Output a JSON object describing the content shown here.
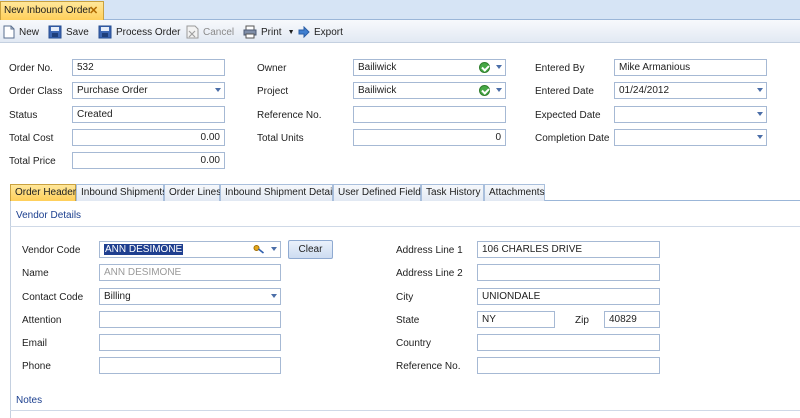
{
  "window": {
    "tab_title": "New Inbound Order",
    "close_glyph": "✕"
  },
  "toolbar": {
    "new": "New",
    "save": "Save",
    "process_order": "Process Order",
    "cancel": "Cancel",
    "print": "Print",
    "export": "Export"
  },
  "form": {
    "order_no": {
      "label": "Order No.",
      "value": "532"
    },
    "order_class": {
      "label": "Order Class",
      "value": "Purchase Order"
    },
    "status": {
      "label": "Status",
      "value": "Created"
    },
    "total_cost": {
      "label": "Total Cost",
      "value": "0.00"
    },
    "total_price": {
      "label": "Total Price",
      "value": "0.00"
    },
    "owner": {
      "label": "Owner",
      "value": "Bailiwick"
    },
    "project": {
      "label": "Project",
      "value": "Bailiwick"
    },
    "reference_no": {
      "label": "Reference No.",
      "value": ""
    },
    "total_units": {
      "label": "Total Units",
      "value": "0"
    },
    "entered_by": {
      "label": "Entered By",
      "value": "Mike Armanious"
    },
    "entered_date": {
      "label": "Entered Date",
      "value": "01/24/2012"
    },
    "expected_date": {
      "label": "Expected Date",
      "value": ""
    },
    "completion_date": {
      "label": "Completion Date",
      "value": ""
    }
  },
  "subtabs": [
    "Order Header",
    "Inbound Shipments",
    "Order Lines",
    "Inbound Shipment Details",
    "User Defined Fields",
    "Task History",
    "Attachments"
  ],
  "vendor": {
    "section_title": "Vendor Details",
    "vendor_code": {
      "label": "Vendor Code",
      "value": "ANN DESIMONE"
    },
    "clear_button": "Clear",
    "name": {
      "label": "Name",
      "value": "ANN DESIMONE"
    },
    "contact_code": {
      "label": "Contact Code",
      "value": "Billing"
    },
    "attention": {
      "label": "Attention",
      "value": ""
    },
    "email": {
      "label": "Email",
      "value": ""
    },
    "phone": {
      "label": "Phone",
      "value": ""
    },
    "address1": {
      "label": "Address Line 1",
      "value": "106 CHARLES DRIVE"
    },
    "address2": {
      "label": "Address Line 2",
      "value": ""
    },
    "city": {
      "label": "City",
      "value": "UNIONDALE"
    },
    "state": {
      "label": "State",
      "value": "NY"
    },
    "zip": {
      "label": "Zip",
      "value": "40829"
    },
    "country": {
      "label": "Country",
      "value": ""
    },
    "reference_no": {
      "label": "Reference No.",
      "value": ""
    }
  },
  "notes": {
    "section_title": "Notes"
  },
  "colors": {
    "accent_tab": "#ffcf5a",
    "section_text": "#1b3f8f",
    "field_border": "#a6b9d4"
  }
}
